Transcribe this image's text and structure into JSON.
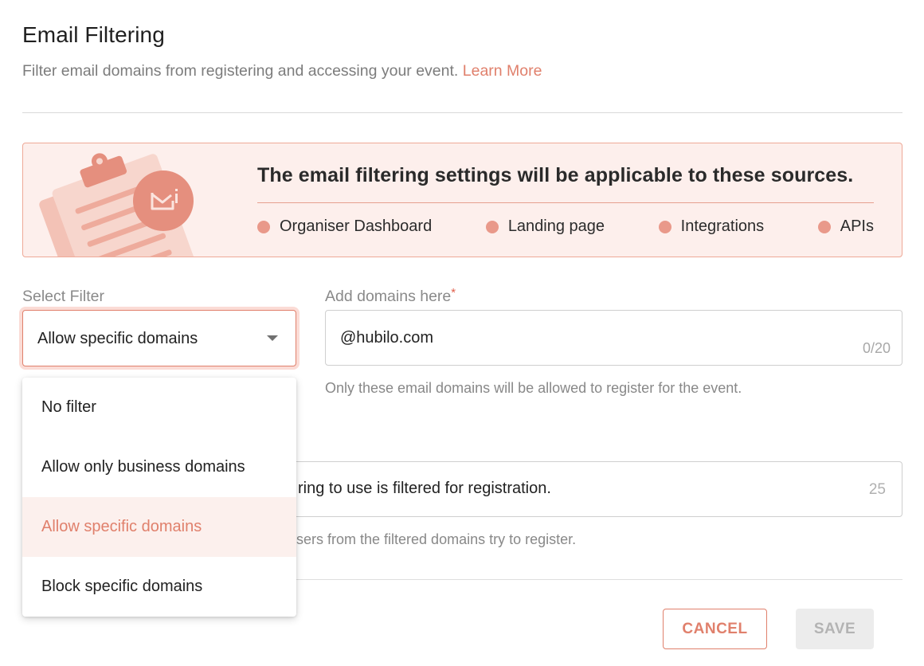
{
  "header": {
    "title": "Email Filtering",
    "subtitle": "Filter email domains from registering and accessing your event.",
    "learn_more": "Learn More"
  },
  "banner": {
    "heading": "The email filtering settings will be applicable to these sources.",
    "sources": [
      "Organiser Dashboard",
      "Landing page",
      "Integrations",
      "APIs"
    ],
    "icons": [
      "clipboard-illustration",
      "mail-icon"
    ]
  },
  "filter": {
    "label": "Select Filter",
    "selected": "Allow specific domains",
    "options": [
      "No filter",
      "Allow only business domains",
      "Allow specific domains",
      "Block specific domains"
    ]
  },
  "domains": {
    "label": "Add domains here",
    "required_mark": "*",
    "chip": "@hubilo.com",
    "counter": "0/20",
    "helper": "Only these email domains will be allowed to register for the event."
  },
  "message": {
    "value_visible": "ring to use is filtered for registration.",
    "counter": "25",
    "helper_visible": "sers from the filtered domains try to register."
  },
  "actions": {
    "cancel": "CANCEL",
    "save": "SAVE"
  },
  "colors": {
    "accent": "#e0806c",
    "banner_bg": "#fdefec",
    "dot": "#e9998a",
    "selected_bg": "#fcf0ed"
  }
}
